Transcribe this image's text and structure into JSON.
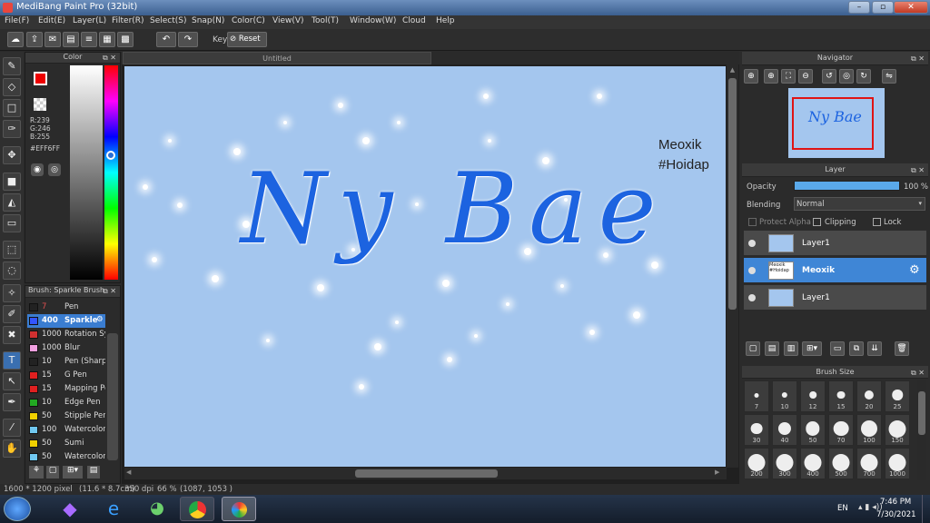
{
  "window": {
    "title": "MediBang Paint Pro (32bit)"
  },
  "menu": [
    "File(F)",
    "Edit(E)",
    "Layer(L)",
    "Filter(R)",
    "Select(S)",
    "Snap(N)",
    "Color(C)",
    "View(V)",
    "Tool(T)",
    "Window(W)",
    "Cloud",
    "Help"
  ],
  "toolbar": {
    "key_label": "Key",
    "reset_label": "Reset"
  },
  "color_panel": {
    "title": "Color",
    "r": "R:239",
    "g": "G:246",
    "b": "B:255",
    "hex": "#EFF6FF"
  },
  "brush_panel": {
    "title": "Brush: Sparkle Brush",
    "items": [
      {
        "size": "7",
        "name": "Pen",
        "color": "#222222"
      },
      {
        "size": "400",
        "name": "Sparkle",
        "color": "#3355ff"
      },
      {
        "size": "1000",
        "name": "Rotation Sy",
        "color": "#d03030"
      },
      {
        "size": "1000",
        "name": "Blur",
        "color": "#f0a0e0"
      },
      {
        "size": "10",
        "name": "Pen (Sharp",
        "color": "#222222"
      },
      {
        "size": "15",
        "name": "G Pen",
        "color": "#e02020"
      },
      {
        "size": "15",
        "name": "Mapping Pe",
        "color": "#e02020"
      },
      {
        "size": "10",
        "name": "Edge Pen",
        "color": "#22aa22"
      },
      {
        "size": "50",
        "name": "Stipple Pen",
        "color": "#f0d000"
      },
      {
        "size": "100",
        "name": "Watercolor",
        "color": "#70c8f0"
      },
      {
        "size": "50",
        "name": "Sumi",
        "color": "#f0d000"
      },
      {
        "size": "50",
        "name": "Watercolor",
        "color": "#70c8f0"
      }
    ]
  },
  "canvas": {
    "tab_title": "Untitled",
    "title_text": "Ny Bae",
    "watermark_line1": "Meoxik",
    "watermark_line2": "#Hoidap"
  },
  "navigator": {
    "title": "Navigator",
    "thumb_text": "Ny Bae"
  },
  "layer_panel": {
    "title": "Layer",
    "opacity_label": "Opacity",
    "opacity_value": "100 %",
    "opacity_level": 1.0,
    "blending_label": "Blending",
    "blending_value": "Normal",
    "protect_alpha": "Protect Alpha",
    "clipping": "Clipping",
    "lock": "Lock",
    "layers": [
      {
        "name": "Layer1",
        "thumb": ""
      },
      {
        "name": "Meoxik",
        "thumb": "Meoxik #Hoidap"
      },
      {
        "name": "Layer1",
        "thumb": ""
      }
    ]
  },
  "brush_size": {
    "title": "Brush Size",
    "sizes": [
      "7",
      "10",
      "12",
      "15",
      "20",
      "25",
      "30",
      "40",
      "50",
      "70",
      "100",
      "150",
      "200",
      "300",
      "400",
      "500",
      "700",
      "1000"
    ]
  },
  "status": {
    "dims": "1600 * 1200 pixel",
    "cm": "(11.6 * 8.7cm)",
    "dpi": "350 dpi",
    "zoom": "66 %",
    "coords": "(1087, 1053 )"
  },
  "taskbar": {
    "lang": "EN",
    "time": "7:46 PM",
    "date": "7/30/2021"
  }
}
